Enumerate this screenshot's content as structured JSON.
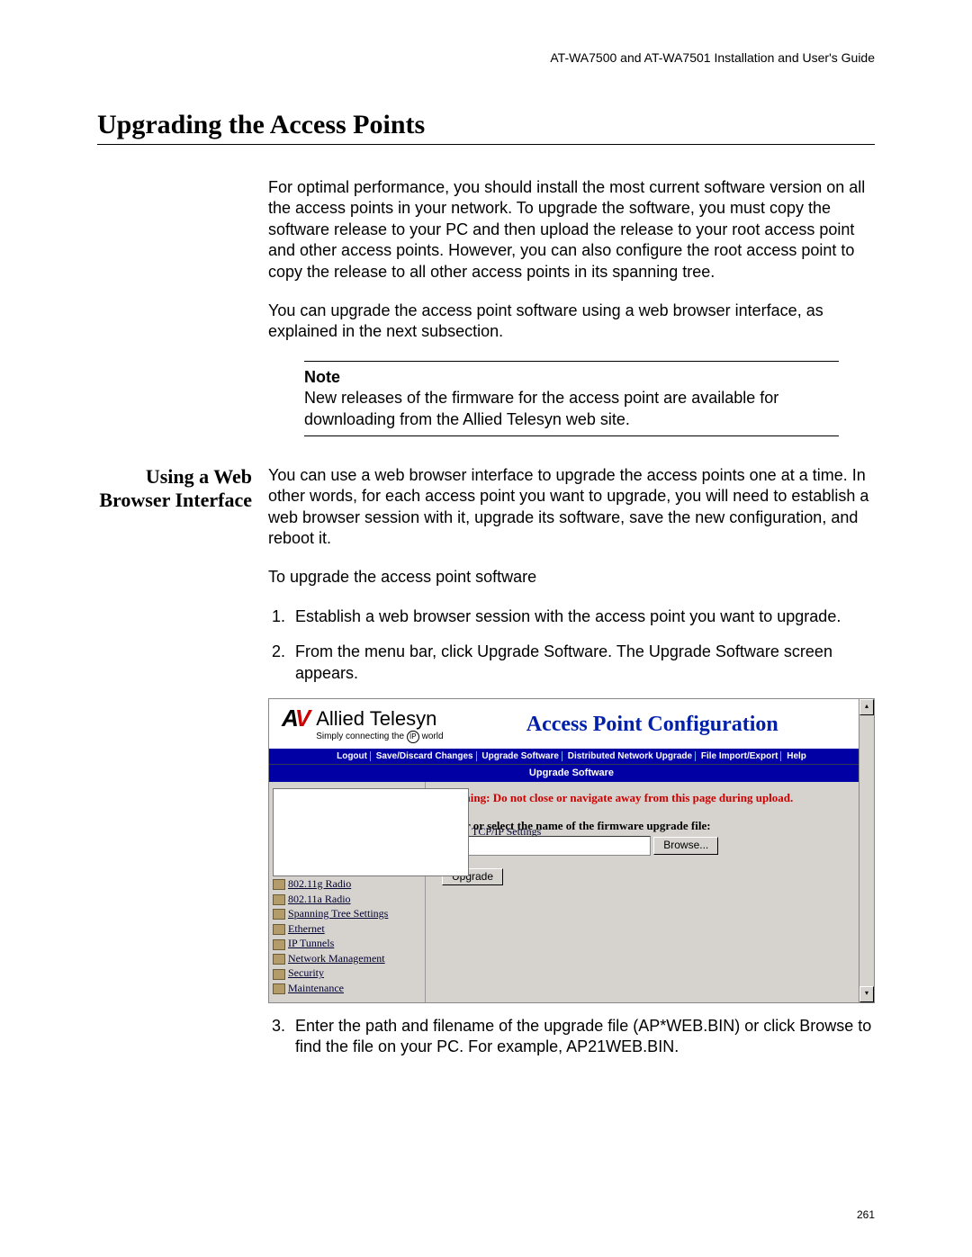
{
  "header": "AT-WA7500 and AT-WA7501 Installation and User's Guide",
  "title": "Upgrading the Access Points",
  "intro": {
    "p1": "For optimal performance, you should install the most current software version on all the access points in your network. To upgrade the software, you must copy the software release to your PC and then upload the release to your root access point and other access points. However, you can also configure the root access point to copy the release to all other access points in its spanning tree.",
    "p2": "You can upgrade the access point software using a web browser interface, as explained in the next subsection."
  },
  "note": {
    "head": "Note",
    "body": "New releases of the firmware for the access point are available for downloading from the Allied Telesyn web site."
  },
  "section": {
    "label": "Using a Web Browser Interface",
    "p1": "You can use a web browser interface to upgrade the access points one at a time. In other words, for each access point you want to upgrade, you will need to establish a web browser session with it, upgrade its software, save the new configuration, and reboot it.",
    "p2": "To upgrade the access point software",
    "steps": {
      "s1": "Establish a web browser session with the access point you want to upgrade.",
      "s2": "From the menu bar, click Upgrade Software. The Upgrade Software screen appears.",
      "s3": "Enter the path and filename of the upgrade file (AP*WEB.BIN) or click Browse to find the file on your PC. For example, AP21WEB.BIN."
    }
  },
  "screenshot": {
    "brand": "Allied Telesyn",
    "tagline_a": "Simply connecting the",
    "tagline_b": "world",
    "title": "Access Point Configuration",
    "menu": [
      "Logout",
      "Save/Discard Changes",
      "Upgrade Software",
      "Distributed Network Upgrade",
      "File Import/Export",
      "Help"
    ],
    "subtitle": "Upgrade Software",
    "nav": [
      "TCP/IP Settings",
      "802.11g Radio",
      "802.11a Radio",
      "Spanning Tree Settings",
      "Ethernet",
      "IP Tunnels",
      "Network Management",
      "Security",
      "Maintenance"
    ],
    "warning": "Warning: Do not close or navigate away from this page during upload.",
    "file_label": "Enter or select the name of the firmware upgrade file:",
    "browse": "Browse...",
    "upgrade": "Upgrade"
  },
  "page_number": "261"
}
